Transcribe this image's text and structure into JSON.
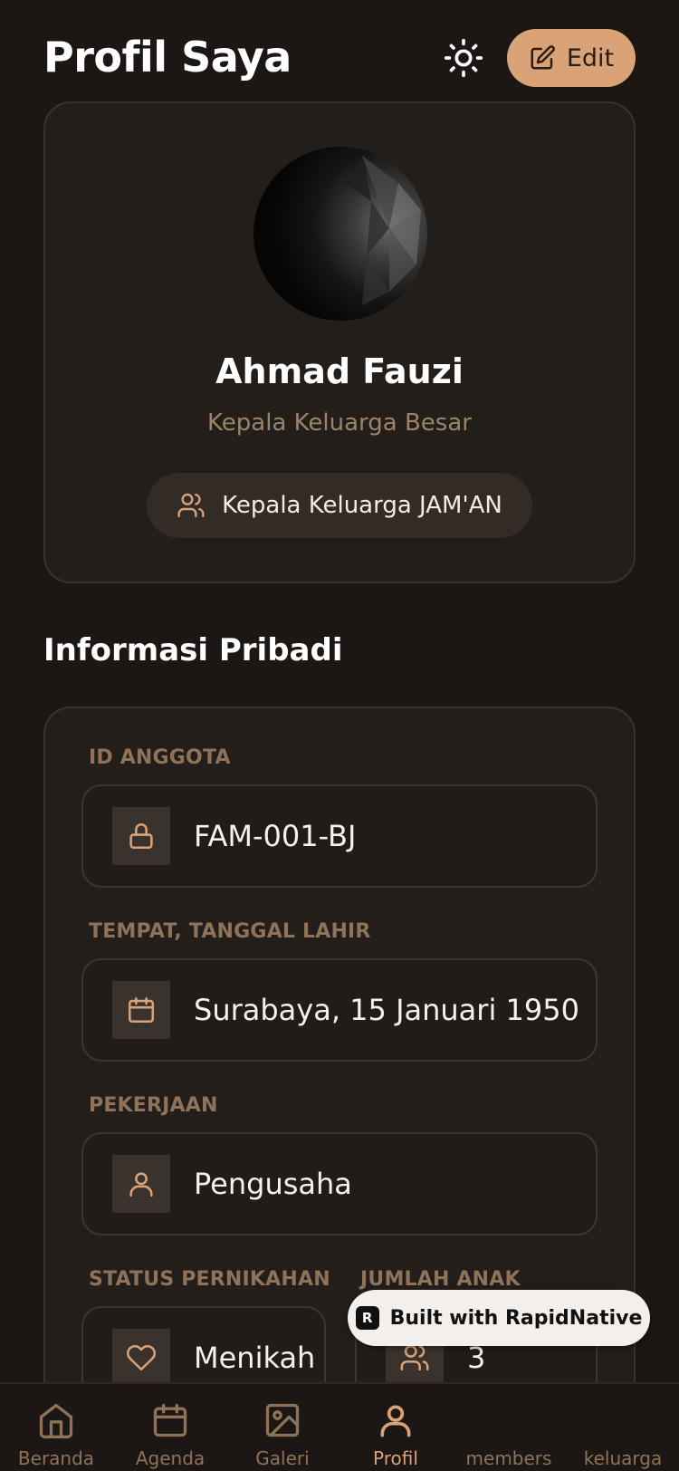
{
  "header": {
    "title": "Profil Saya",
    "edit_label": "Edit"
  },
  "profile": {
    "name": "Ahmad Fauzi",
    "role": "Kepala Keluarga Besar",
    "family_label": "Kepala Keluarga JAM'AN"
  },
  "personal_info": {
    "section_title": "Informasi Pribadi",
    "fields": [
      {
        "label": "ID ANGGOTA",
        "value": "FAM-001-BJ",
        "icon": "lock-icon"
      },
      {
        "label": "TEMPAT, TANGGAL LAHIR",
        "value": "Surabaya, 15 Januari 1950",
        "icon": "calendar-icon"
      },
      {
        "label": "PEKERJAAN",
        "value": "Pengusaha",
        "icon": "user-icon"
      },
      {
        "label": "STATUS PERNIKAHAN",
        "value": "Menikah",
        "icon": "heart-icon"
      },
      {
        "label": "JUMLAH ANAK",
        "value": "3",
        "icon": "users-icon"
      }
    ]
  },
  "badge": {
    "text": "Built with RapidNative"
  },
  "bottom_nav": {
    "items": [
      {
        "label": "Beranda",
        "icon": "home-icon",
        "active": false
      },
      {
        "label": "Agenda",
        "icon": "calendar-icon",
        "active": false
      },
      {
        "label": "Galeri",
        "icon": "image-icon",
        "active": false
      },
      {
        "label": "Profil",
        "icon": "user-icon",
        "active": true
      },
      {
        "label": "members",
        "icon": "",
        "active": false
      },
      {
        "label": "keluarga",
        "icon": "",
        "active": false
      }
    ]
  },
  "colors": {
    "accent": "#d9a277",
    "background": "#1c1714",
    "card": "#241e1a",
    "muted": "#8e7359"
  }
}
